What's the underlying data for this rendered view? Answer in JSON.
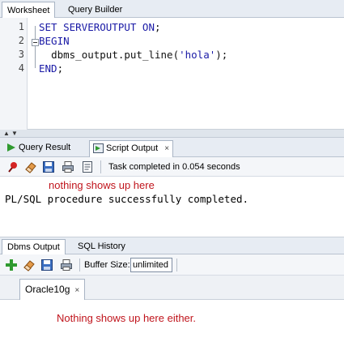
{
  "top_tabs": [
    {
      "label": "Worksheet",
      "active": true
    },
    {
      "label": "Query Builder",
      "active": false
    }
  ],
  "editor": {
    "line_numbers": [
      "1",
      "2",
      "3",
      "4"
    ],
    "lines": [
      {
        "pre": "SET SERVEROUTPUT ON",
        "punct": ";"
      },
      {
        "pre": "BEGIN",
        "punct": ""
      },
      {
        "indent": "  ",
        "call": "dbms_output.put_line(",
        "str": "'hola'",
        "end": ");"
      },
      {
        "pre": "END",
        "punct": ";"
      }
    ]
  },
  "output_tabs": [
    {
      "label": "Query Result",
      "icon": "play-icon",
      "active": false
    },
    {
      "label": "Script Output",
      "icon": "script-output-icon",
      "active": true,
      "close": "×"
    }
  ],
  "script_toolbar": {
    "status": "Task completed in 0.054 seconds"
  },
  "script_output": {
    "annotation": "nothing shows up here",
    "message": "PL/SQL procedure successfully completed."
  },
  "dbms_tabs": [
    {
      "label": "Dbms Output",
      "active": true
    },
    {
      "label": "SQL History",
      "active": false
    }
  ],
  "dbms_toolbar": {
    "buffer_label": "Buffer Size:",
    "buffer_value": "unlimited"
  },
  "connection_tab": {
    "label": "Oracle10g",
    "close": "×"
  },
  "dbms_output": {
    "annotation": "Nothing shows up here either."
  },
  "colors": {
    "annotation_red": "#c0141c",
    "keyword_blue": "#1a1aa6"
  }
}
